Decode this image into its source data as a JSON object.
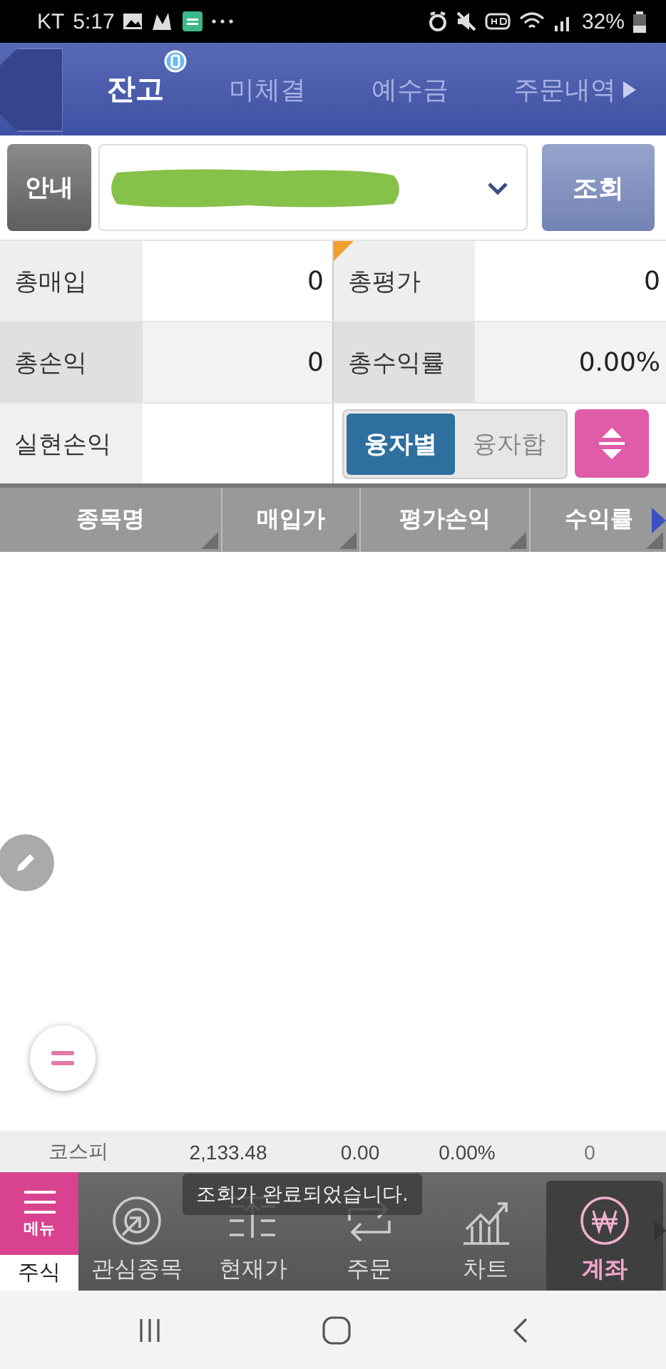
{
  "status_bar": {
    "carrier": "KT",
    "time": "5:17",
    "battery": "32%"
  },
  "tabs": [
    {
      "label": "잔고",
      "selected": true,
      "badge": true
    },
    {
      "label": "미체결",
      "selected": false,
      "badge": false
    },
    {
      "label": "예수금",
      "selected": false,
      "badge": false
    },
    {
      "label": "주문내역",
      "selected": false,
      "badge": false
    }
  ],
  "account": {
    "info_button": "안내",
    "query_button": "조회"
  },
  "summary": [
    [
      {
        "label": "총매입",
        "value": "0",
        "flag": false
      },
      {
        "label": "총평가",
        "value": "0",
        "flag": true
      }
    ],
    [
      {
        "label": "총손익",
        "value": "0",
        "flag": false
      },
      {
        "label": "총수익률",
        "value": "0.00%",
        "flag": false
      }
    ],
    [
      {
        "label": "실현손익"
      }
    ]
  ],
  "segments": [
    {
      "label": "융자별",
      "selected": true
    },
    {
      "label": "융자합",
      "selected": false
    }
  ],
  "columns": [
    "종목명",
    "매입가",
    "평가손익",
    "수익률"
  ],
  "ticker": [
    "코스피",
    "2,133.48",
    "0.00",
    "0.00%",
    "0"
  ],
  "toast": "조회가 완료되었습니다.",
  "menu": {
    "label": "메뉴",
    "section": "주식"
  },
  "nav": [
    {
      "label": "관심종목",
      "kind": "watch",
      "selected": false
    },
    {
      "label": "현재가",
      "kind": "price",
      "selected": false
    },
    {
      "label": "주문",
      "kind": "order",
      "selected": false
    },
    {
      "label": "차트",
      "kind": "chart",
      "selected": false
    },
    {
      "label": "계좌",
      "kind": "account",
      "selected": true
    }
  ]
}
